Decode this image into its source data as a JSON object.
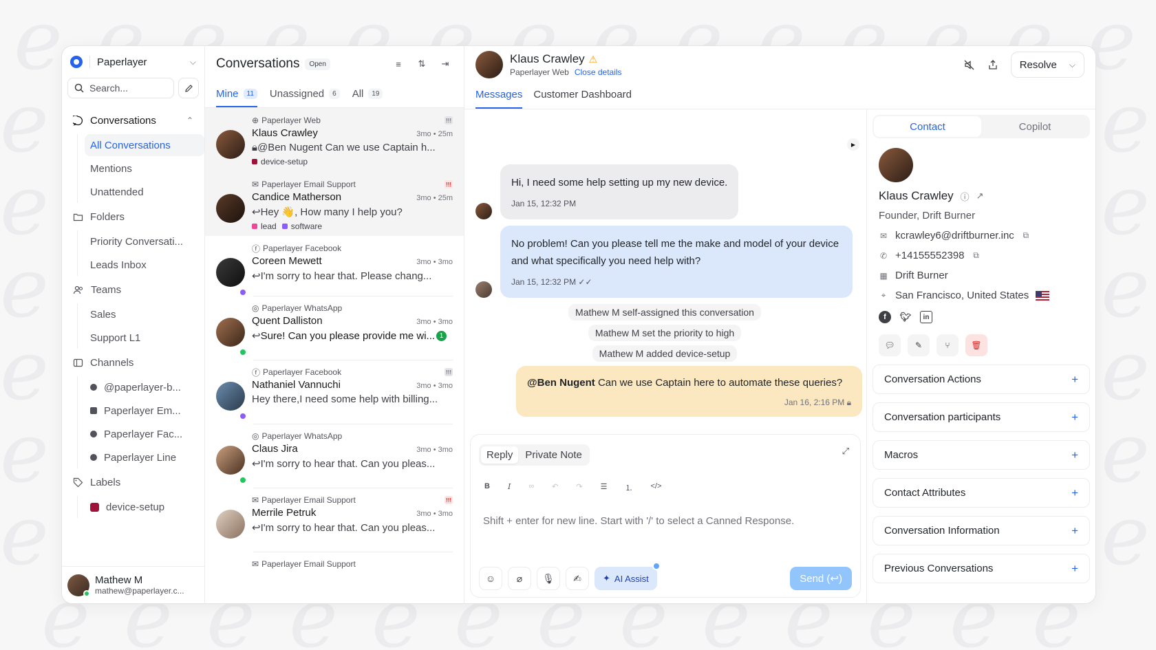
{
  "workspace": {
    "name": "Paperlayer"
  },
  "sidebar": {
    "search_placeholder": "Search...",
    "conversations": {
      "label": "Conversations",
      "items": [
        "All Conversations",
        "Mentions",
        "Unattended"
      ]
    },
    "folders": {
      "label": "Folders",
      "items": [
        "Priority Conversati...",
        "Leads Inbox"
      ]
    },
    "teams": {
      "label": "Teams",
      "items": [
        "Sales",
        "Support L1"
      ]
    },
    "channels": {
      "label": "Channels",
      "items": [
        "@paperlayer-b...",
        "Paperlayer Em...",
        "Paperlayer Fac...",
        "Paperlayer Line"
      ]
    },
    "labels": {
      "label": "Labels",
      "items": [
        {
          "name": "device-setup",
          "color": "#9f1239"
        }
      ]
    },
    "user": {
      "name": "Mathew M",
      "email": "mathew@paperlayer.c..."
    }
  },
  "conversation_list": {
    "title": "Conversations",
    "status": "Open",
    "tabs": [
      {
        "label": "Mine",
        "count": "11"
      },
      {
        "label": "Unassigned",
        "count": "6"
      },
      {
        "label": "All",
        "count": "19"
      }
    ],
    "items": [
      {
        "inbox": "Paperlayer Web",
        "name": "Klaus Crawley",
        "time": "3mo • 25m",
        "message": "@Ben Nugent Can we use Captain h...",
        "tags": [
          {
            "name": "device-setup",
            "color": "#9f1239"
          }
        ],
        "priority": "!!!"
      },
      {
        "inbox": "Paperlayer Email Support",
        "name": "Candice Matherson",
        "time": "3mo • 25m",
        "message": "Hey 👋, How many I help you?",
        "tags": [
          {
            "name": "lead",
            "color": "#ec4899"
          },
          {
            "name": "software",
            "color": "#8b5cf6"
          }
        ],
        "priority": "!!!"
      },
      {
        "inbox": "Paperlayer Facebook",
        "name": "Coreen Mewett",
        "time": "3mo • 3mo",
        "message": "I'm sorry to hear that. Please chang..."
      },
      {
        "inbox": "Paperlayer WhatsApp",
        "name": "Quent Dalliston",
        "time": "3mo • 3mo",
        "message": "Sure! Can you please provide me wi...",
        "unread": "1"
      },
      {
        "inbox": "Paperlayer Facebook",
        "name": "Nathaniel Vannuchi",
        "time": "3mo • 3mo",
        "message": "Hey there,I need some help with billing...",
        "priority": "!!!"
      },
      {
        "inbox": "Paperlayer WhatsApp",
        "name": "Claus Jira",
        "time": "3mo • 3mo",
        "message": "I'm sorry to hear that. Can you pleas..."
      },
      {
        "inbox": "Paperlayer Email Support",
        "name": "Merrile Petruk",
        "time": "3mo • 3mo",
        "message": "I'm sorry to hear that. Can you pleas...",
        "priority": "!!!"
      },
      {
        "inbox": "Paperlayer Email Support"
      }
    ]
  },
  "conversation": {
    "contact_name": "Klaus Crawley",
    "inbox": "Paperlayer Web",
    "close_details": "Close details",
    "resolve_label": "Resolve",
    "tabs": [
      "Messages",
      "Customer Dashboard"
    ],
    "messages": [
      {
        "text": "Hi, I need some help setting up my new device.",
        "time": "Jan 15, 12:32 PM"
      },
      {
        "text": "No problem! Can you please tell me the make and model of your device and what specifically you need help with?",
        "time": "Jan 15, 12:32 PM"
      }
    ],
    "activities": [
      "Mathew M self-assigned this conversation",
      "Mathew M set the priority to high",
      "Mathew M added device-setup"
    ],
    "note": {
      "mention": "@Ben Nugent",
      "text": " Can we use Captain here to automate these queries?",
      "time": "Jan 16, 2:16 PM"
    },
    "composer": {
      "modes": [
        "Reply",
        "Private Note"
      ],
      "placeholder": "Shift + enter for new line. Start with '/' to select a Canned Response.",
      "ai_assist": "AI Assist",
      "send": "Send (↩)"
    }
  },
  "contact": {
    "tabs": [
      "Contact",
      "Copilot"
    ],
    "name": "Klaus Crawley",
    "role": "Founder, Drift Burner",
    "email": "kcrawley6@driftburner.inc",
    "phone": "+14155552398",
    "company": "Drift Burner",
    "location": "San Francisco, United States",
    "sections": [
      "Conversation Actions",
      "Conversation participants",
      "Macros",
      "Contact Attributes",
      "Conversation Information",
      "Previous Conversations"
    ]
  }
}
